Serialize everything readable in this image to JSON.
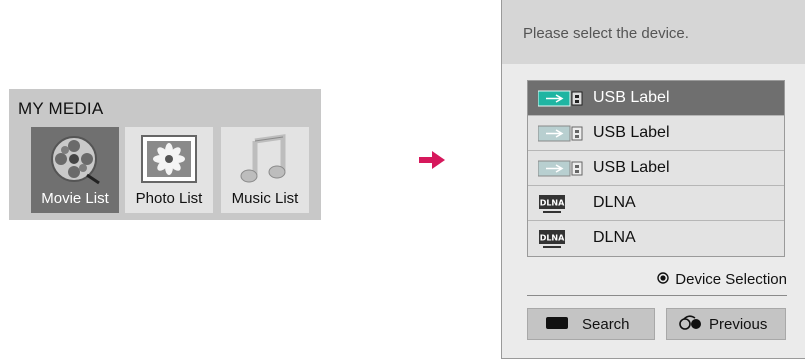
{
  "my_media": {
    "title": "MY MEDIA",
    "tiles": [
      {
        "label": "Movie List",
        "icon": "film-reel-icon",
        "selected": true
      },
      {
        "label": "Photo List",
        "icon": "photo-icon",
        "selected": false
      },
      {
        "label": "Music List",
        "icon": "music-note-icon",
        "selected": false
      }
    ]
  },
  "dialog": {
    "prompt": "Please select the device.",
    "devices": [
      {
        "label": "USB Label",
        "icon": "usb-icon",
        "selected": true
      },
      {
        "label": "USB Label",
        "icon": "usb-icon",
        "selected": false
      },
      {
        "label": "USB Label",
        "icon": "usb-icon",
        "selected": false
      },
      {
        "label": "DLNA",
        "icon": "dlna-icon",
        "selected": false
      },
      {
        "label": "DLNA",
        "icon": "dlna-icon",
        "selected": false
      }
    ],
    "device_selection_label": "Device Selection",
    "buttons": {
      "search": "Search",
      "previous": "Previous"
    }
  },
  "colors": {
    "arrow": "#d6185c",
    "usb_selected": "#1fb5a2",
    "usb_idle": "#a9c8c9"
  }
}
